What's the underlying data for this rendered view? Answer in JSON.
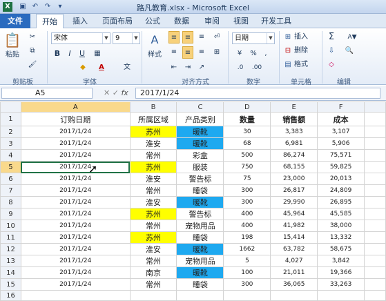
{
  "window": {
    "title": "路凡教育.xlsx - Microsoft Excel"
  },
  "quick_access": [
    "save-icon",
    "undo-icon",
    "redo-icon"
  ],
  "tabs": [
    "文件",
    "开始",
    "插入",
    "页面布局",
    "公式",
    "数据",
    "审阅",
    "视图",
    "开发工具"
  ],
  "ribbon": {
    "clipboard": {
      "paste_label": "粘贴",
      "group": "剪贴板"
    },
    "font": {
      "name": "宋体",
      "size": "9",
      "bold": "B",
      "italic": "I",
      "underline": "U",
      "group": "字体",
      "font_color": "A",
      "grow": "A",
      "shrink": "A"
    },
    "alignment": {
      "group": "对齐方式"
    },
    "style": {
      "label": "样式"
    },
    "number": {
      "format": "日期",
      "percent": "%",
      "comma": ",",
      "group": "数字"
    },
    "cells": {
      "insert": "插入",
      "delete": "删除",
      "format": "格式",
      "group": "单元格"
    },
    "editing": {
      "sum": "Σ",
      "sort": "A▼",
      "group": "编辑"
    }
  },
  "formula_bar": {
    "name_box": "A5",
    "fx": "fx",
    "formula": "2017/1/24"
  },
  "columns": [
    "A",
    "B",
    "C",
    "D",
    "E",
    "F"
  ],
  "headers": [
    "订购日期",
    "所属区域",
    "产品类别",
    "数量",
    "销售额",
    "成本"
  ],
  "rows": [
    [
      "2017/1/24",
      "苏州",
      "暖靴",
      "30",
      "3,383",
      "3,107"
    ],
    [
      "2017/1/24",
      "淮安",
      "暖靴",
      "68",
      "6,981",
      "5,906"
    ],
    [
      "2017/1/24",
      "常州",
      "彩盒",
      "500",
      "86,274",
      "75,571"
    ],
    [
      "2017/1/24",
      "苏州",
      "服装",
      "750",
      "68,155",
      "59,825"
    ],
    [
      "2017/1/24",
      "淮安",
      "警告标",
      "75",
      "23,000",
      "20,013"
    ],
    [
      "2017/1/24",
      "常州",
      "睡袋",
      "300",
      "26,817",
      "24,809"
    ],
    [
      "2017/1/24",
      "淮安",
      "暖靴",
      "300",
      "29,990",
      "26,895"
    ],
    [
      "2017/1/24",
      "苏州",
      "警告标",
      "400",
      "45,964",
      "45,585"
    ],
    [
      "2017/1/24",
      "常州",
      "宠物用品",
      "400",
      "41,982",
      "38,000"
    ],
    [
      "2017/1/24",
      "苏州",
      "睡袋",
      "198",
      "15,414",
      "13,332"
    ],
    [
      "2017/1/24",
      "淮安",
      "暖靴",
      "1662",
      "63,782",
      "58,675"
    ],
    [
      "2017/1/24",
      "常州",
      "宠物用品",
      "5",
      "4,027",
      "3,842"
    ],
    [
      "2017/1/24",
      "南京",
      "暖靴",
      "100",
      "21,011",
      "19,366"
    ],
    [
      "2017/1/24",
      "常州",
      "睡袋",
      "300",
      "36,065",
      "33,263"
    ]
  ],
  "row_numbers": [
    "1",
    "2",
    "3",
    "4",
    "5",
    "6",
    "7",
    "8",
    "9",
    "10",
    "11",
    "12",
    "13",
    "14",
    "15",
    "16"
  ],
  "colors": {
    "region_highlight": "#ffff00",
    "category_highlight": "#1ea9f0",
    "selection": "#f9d98c"
  }
}
